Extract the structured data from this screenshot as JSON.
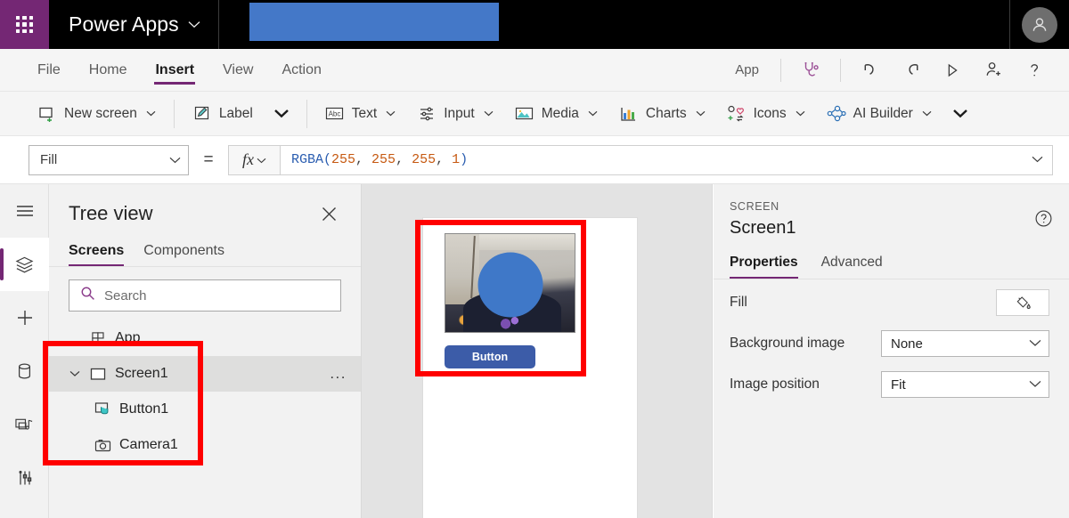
{
  "topbar": {
    "waffle_icon": "app-launcher-waffle-icon",
    "brand": "Power Apps",
    "brand_chevron": "chevron-down-icon",
    "redacted_app_name": "",
    "avatar_icon": "user-avatar-icon",
    "colors": {
      "waffle_bg": "#742774",
      "bar_bg": "#000000",
      "redaction": "#4478c8"
    }
  },
  "menubar": {
    "items": [
      {
        "label": "File",
        "active": false
      },
      {
        "label": "Home",
        "active": false
      },
      {
        "label": "Insert",
        "active": true
      },
      {
        "label": "View",
        "active": false
      },
      {
        "label": "Action",
        "active": false
      }
    ],
    "app_label": "App",
    "right_icons": [
      {
        "name": "app-checker-stethoscope-icon"
      },
      {
        "name": "undo-icon"
      },
      {
        "name": "redo-icon"
      },
      {
        "name": "preview-play-icon"
      },
      {
        "name": "share-add-user-icon"
      },
      {
        "name": "help-question-icon"
      }
    ],
    "accent": "#742774"
  },
  "ribbon": {
    "items": [
      {
        "label": "New screen",
        "icon": "new-screen-icon",
        "chevron": true
      },
      {
        "label": "Label",
        "icon": "label-pencil-icon",
        "chevron": false,
        "big_caret": true
      },
      {
        "label": "Text",
        "icon": "text-abc-icon",
        "chevron": true
      },
      {
        "label": "Input",
        "icon": "input-sliders-icon",
        "chevron": true
      },
      {
        "label": "Media",
        "icon": "media-image-icon",
        "chevron": true
      },
      {
        "label": "Charts",
        "icon": "charts-bar-icon",
        "chevron": true
      },
      {
        "label": "Icons",
        "icon": "icons-shapes-icon",
        "chevron": true
      },
      {
        "label": "AI Builder",
        "icon": "ai-builder-nodes-icon",
        "chevron": true
      }
    ],
    "overflow_caret": "chevron-down-icon"
  },
  "formulabar": {
    "property": "Fill",
    "property_chevron": "chevron-down-icon",
    "equals": "=",
    "fx_label": "fx",
    "fx_chevron": "chevron-down-icon",
    "formula_tokens": [
      {
        "text": "RGBA(",
        "type": "fn"
      },
      {
        "text": "255",
        "type": "num"
      },
      {
        "text": ", ",
        "type": "pl"
      },
      {
        "text": "255",
        "type": "num"
      },
      {
        "text": ", ",
        "type": "pl"
      },
      {
        "text": "255",
        "type": "num"
      },
      {
        "text": ", ",
        "type": "pl"
      },
      {
        "text": "1",
        "type": "num"
      },
      {
        "text": ")",
        "type": "fn"
      }
    ],
    "formula_text": "RGBA(255, 255, 255, 1)",
    "expand_chevron": "chevron-down-icon"
  },
  "rail": {
    "items": [
      {
        "name": "hamburger-menu-icon",
        "active": false
      },
      {
        "name": "tree-view-layers-icon",
        "active": true
      },
      {
        "name": "insert-plus-icon",
        "active": false
      },
      {
        "name": "data-cylinder-icon",
        "active": false
      },
      {
        "name": "media-library-icon",
        "active": false
      },
      {
        "name": "variables-tools-icon",
        "active": false
      }
    ],
    "accent": "#742774"
  },
  "treeview": {
    "title": "Tree view",
    "close_icon": "close-icon",
    "tabs": [
      {
        "label": "Screens",
        "active": true
      },
      {
        "label": "Components",
        "active": false
      }
    ],
    "search_placeholder": "Search",
    "search_value": "",
    "search_icon": "search-icon",
    "nodes": [
      {
        "label": "App",
        "icon": "app-grid-icon",
        "level": 0,
        "selected": false,
        "caret": "",
        "menu": false
      },
      {
        "label": "Screen1",
        "icon": "screen-rect-icon",
        "level": 0,
        "selected": true,
        "caret": "chevron-down-icon",
        "menu": true
      },
      {
        "label": "Button1",
        "icon": "button-click-icon",
        "level": 1,
        "selected": false,
        "caret": "",
        "menu": false
      },
      {
        "label": "Camera1",
        "icon": "camera-icon",
        "level": 1,
        "selected": false,
        "caret": "",
        "menu": false
      }
    ],
    "overflow_label": "..."
  },
  "canvas": {
    "screen_name": "Screen1",
    "camera_control": "Camera1",
    "camera_redaction_color": "#3f78c8",
    "button": {
      "label": "Button",
      "fill": "#3c5ca8",
      "text_color": "#ffffff"
    },
    "background": "#e3e3e3",
    "screen_fill": "#ffffff"
  },
  "properties": {
    "kicker": "SCREEN",
    "name": "Screen1",
    "help_icon": "help-circle-icon",
    "tabs": [
      {
        "label": "Properties",
        "active": true
      },
      {
        "label": "Advanced",
        "active": false
      }
    ],
    "rows": [
      {
        "label": "Fill",
        "control": "swatch",
        "value": "",
        "icon": "paint-bucket-icon"
      },
      {
        "label": "Background image",
        "control": "dropdown",
        "value": "None",
        "icon": "chevron-down-icon"
      },
      {
        "label": "Image position",
        "control": "dropdown",
        "value": "Fit",
        "icon": "chevron-down-icon"
      }
    ]
  },
  "annotations": [
    {
      "name": "tree-nodes-highlight",
      "color": "#ff0000"
    },
    {
      "name": "canvas-preview-highlight",
      "color": "#ff0000"
    }
  ]
}
